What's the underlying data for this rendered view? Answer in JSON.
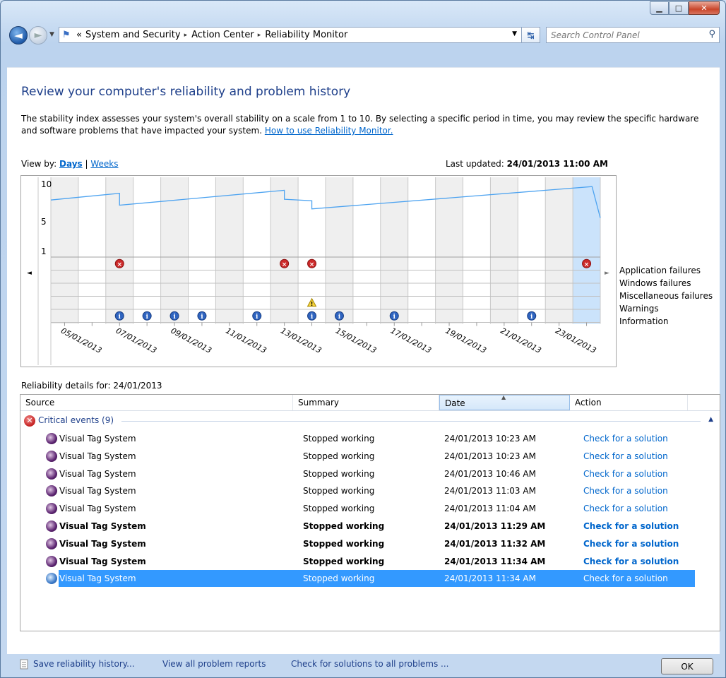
{
  "window": {
    "buttons": {
      "minimize": "▁",
      "maximize": "□",
      "close": "✕"
    }
  },
  "nav": {
    "back_icon": "back-arrow-icon",
    "forward_icon": "forward-arrow-icon",
    "address": {
      "root_glyph": "«",
      "segments": [
        "System and Security",
        "Action Center",
        "Reliability Monitor"
      ],
      "separator": "▸"
    },
    "search_placeholder": "Search Control Panel"
  },
  "page": {
    "title": "Review your computer's reliability and problem history",
    "description": "The stability index assesses your system's overall stability on a scale from 1 to 10. By selecting a specific period in time, you may review the specific hardware and software problems that have impacted your system.",
    "help_link": "How to use Reliability Monitor.",
    "view_by_label": "View by:",
    "view_days": "Days",
    "view_separator": "|",
    "view_weeks": "Weeks",
    "last_updated_label": "Last updated:",
    "last_updated_value": "24/01/2013 11:00 AM"
  },
  "chart_data": {
    "type": "line",
    "y_ticks": [
      "10",
      "5",
      "1"
    ],
    "ylim": [
      1,
      10
    ],
    "x_labels": [
      "05/01/2013",
      "07/01/2013",
      "09/01/2013",
      "11/01/2013",
      "13/01/2013",
      "15/01/2013",
      "17/01/2013",
      "19/01/2013",
      "21/01/2013",
      "23/01/2013"
    ],
    "columns": 20,
    "selected_column": 19,
    "stability_points": [
      [
        0,
        7.9
      ],
      [
        2.5,
        8.8
      ],
      [
        2.5,
        7.2
      ],
      [
        8.5,
        9.2
      ],
      [
        8.5,
        8.0
      ],
      [
        9.5,
        7.8
      ],
      [
        9.5,
        6.7
      ],
      [
        19.7,
        9.7
      ],
      [
        20,
        5.5
      ]
    ],
    "categories": [
      "Application failures",
      "Windows failures",
      "Miscellaneous failures",
      "Warnings",
      "Information"
    ],
    "events": {
      "Application failures": [
        2,
        8,
        9,
        19
      ],
      "Windows failures": [],
      "Miscellaneous failures": [],
      "Warnings": [
        9
      ],
      "Information": [
        2,
        3,
        4,
        5,
        7,
        9,
        10,
        12,
        17
      ]
    }
  },
  "details": {
    "label": "Reliability details for: 24/01/2013",
    "columns": [
      "Source",
      "Summary",
      "Date",
      "Action"
    ],
    "group": "Critical events (9)",
    "rows": [
      {
        "source": "Visual Tag System",
        "summary": "Stopped working",
        "date": "24/01/2013 10:23 AM",
        "action": "Check for a solution"
      },
      {
        "source": "Visual Tag System",
        "summary": "Stopped working",
        "date": "24/01/2013 10:23 AM",
        "action": "Check for a solution"
      },
      {
        "source": "Visual Tag System",
        "summary": "Stopped working",
        "date": "24/01/2013 10:46 AM",
        "action": "Check for a solution"
      },
      {
        "source": "Visual Tag System",
        "summary": "Stopped working",
        "date": "24/01/2013 11:03 AM",
        "action": "Check for a solution"
      },
      {
        "source": "Visual Tag System",
        "summary": "Stopped working",
        "date": "24/01/2013 11:04 AM",
        "action": "Check for a solution"
      },
      {
        "source": "Visual Tag System",
        "summary": "Stopped working",
        "date": "24/01/2013 11:29 AM",
        "action": "Check for a solution"
      },
      {
        "source": "Visual Tag System",
        "summary": "Stopped working",
        "date": "24/01/2013 11:32 AM",
        "action": "Check for a solution"
      },
      {
        "source": "Visual Tag System",
        "summary": "Stopped working",
        "date": "24/01/2013 11:34 AM",
        "action": "Check for a solution"
      },
      {
        "source": "Visual Tag System",
        "summary": "Stopped working",
        "date": "24/01/2013 11:34 AM",
        "action": "Check for a solution"
      }
    ]
  },
  "footer": {
    "save_link": "Save reliability history...",
    "view_all_link": "View all problem reports",
    "check_all_link": "Check for solutions to all problems ...",
    "ok_label": "OK"
  },
  "colors": {
    "title": "#1e3f8a",
    "link": "#0066cc",
    "selected_row": "#3399ff",
    "stability_line": "#4da3f0",
    "selected_column": "#cbe3fb"
  }
}
